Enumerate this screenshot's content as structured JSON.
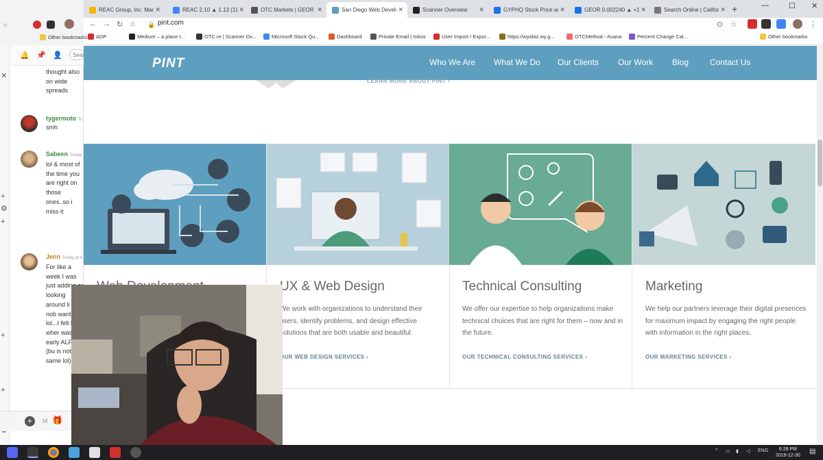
{
  "browser": {
    "tabs": [
      {
        "label": "REAC Group, Inc. Mark",
        "fav": "#f4b400"
      },
      {
        "label": "REAC 2.10 ▲ 1.13 (116",
        "fav": "#4285f4"
      },
      {
        "label": "OTC Markets | GEOR",
        "fav": "#555"
      },
      {
        "label": "San Diego Web Develo",
        "fav": "#5e9fbf"
      },
      {
        "label": "Scanner Overview",
        "fav": "#222"
      },
      {
        "label": "GYPHQ Stock Price and",
        "fav": "#1a73e8"
      },
      {
        "label": "GEOR 0.002240 ▲ +10",
        "fav": "#1a73e8"
      },
      {
        "label": "Search Online | Califor",
        "fav": "#777"
      }
    ],
    "url": "pint.com",
    "bookmarks": [
      {
        "label": "ADP",
        "color": "#d32f2f"
      },
      {
        "label": "Medium – a place t...",
        "color": "#222"
      },
      {
        "label": "OTC.re | Scanner Ov...",
        "color": "#333"
      },
      {
        "label": "Microsoft Stock Qu...",
        "color": "#4285f4"
      },
      {
        "label": "Dashboard",
        "color": "#e2572c"
      },
      {
        "label": "Private Email | Inbox",
        "color": "#555"
      },
      {
        "label": "User Import / Expor...",
        "color": "#d32f2f"
      },
      {
        "label": "https://wyobiz.wy.g...",
        "color": "#8a6d1e"
      },
      {
        "label": "OTCMethod - Asana",
        "color": "#f06a6a"
      },
      {
        "label": "Percent Change Cal...",
        "color": "#7e57c2"
      }
    ],
    "other_bookmarks": "Other bookmarks",
    "left_other_bookmarks": "Other bookmarks"
  },
  "chat": {
    "search_placeholder": "Sear",
    "messages": [
      {
        "user": "",
        "time": "",
        "text": "thought also on wide spreads"
      },
      {
        "user": "tygermoto",
        "time": "To",
        "text": "smh"
      },
      {
        "user": "Sabeen",
        "time": "Today",
        "text": "lol & most of the time you are right on those ones..so i miss it"
      },
      {
        "user": "Jenn",
        "time": "Today at 6",
        "text": "For like a week I was just adding ar looking around li why nob wants th lol...I felt like wher was early ALPP (bu is not the same lol)"
      }
    ]
  },
  "site": {
    "logo": "PINT",
    "nav": [
      "Who We Are",
      "What We Do",
      "Our Clients",
      "Our Work",
      "Blog",
      "Contact Us"
    ],
    "learn_more": "LEARN MORE ABOUT PINT",
    "cards": [
      {
        "title": "Web Development",
        "text": "",
        "link": "",
        "bg": "#5e9fbf"
      },
      {
        "title": "UX & Web Design",
        "text": "We work with organizations to understand their users, identify problems, and design effective solutions that are both usable and beautiful.",
        "link": "OUR WEB DESIGN SERVICES",
        "bg": "#b7d1dc"
      },
      {
        "title": "Technical Consulting",
        "text": "We offer our expertise to help organizations make technical choices that are right for them – now and in the future.",
        "link": "OUR TECHNICAL CONSULTING SERVICES",
        "bg": "#69ab95"
      },
      {
        "title": "Marketing",
        "text": "We help our partners leverage their digital presences for maximum impact by engaging the right people with information in the right places.",
        "link": "OUR MARKETING SERVICES",
        "bg": "#c5d6d6"
      }
    ]
  },
  "taskbar": {
    "lang": "ENG",
    "time": "6:28 PM",
    "date": "2019-12-30"
  }
}
